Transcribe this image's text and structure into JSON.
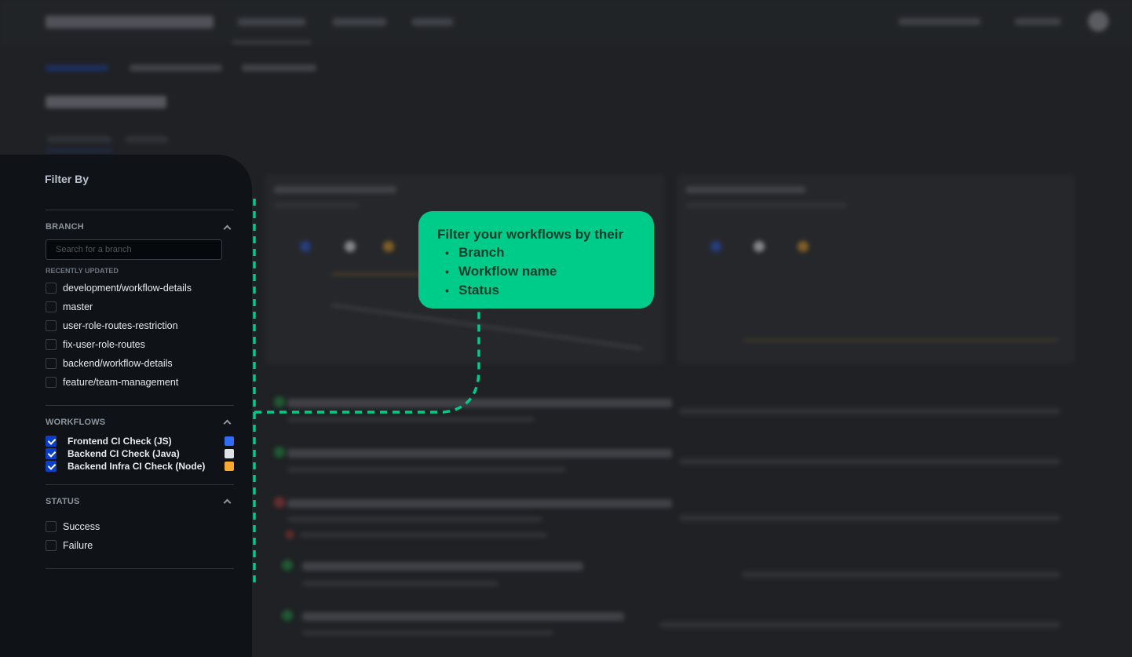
{
  "filter_panel": {
    "title": "Filter By",
    "branch": {
      "section_title": "BRANCH",
      "search_placeholder": "Search for a branch",
      "search_value": "",
      "recent_label": "RECENTLY UPDATED",
      "items": [
        {
          "label": "development/workflow-details",
          "checked": false
        },
        {
          "label": "master",
          "checked": false
        },
        {
          "label": "user-role-routes-restriction",
          "checked": false
        },
        {
          "label": "fix-user-role-routes",
          "checked": false
        },
        {
          "label": "backend/workflow-details",
          "checked": false
        },
        {
          "label": "feature/team-management",
          "checked": false
        }
      ]
    },
    "workflows": {
      "section_title": "WORKFLOWS",
      "items": [
        {
          "label": "Frontend CI Check (JS)",
          "checked": true,
          "color": "#2f6df6"
        },
        {
          "label": "Backend CI Check (Java)",
          "checked": true,
          "color": "#dfe2e7"
        },
        {
          "label": "Backend Infra CI Check (Node)",
          "checked": true,
          "color": "#f9a92f"
        }
      ]
    },
    "status": {
      "section_title": "STATUS",
      "items": [
        {
          "label": "Success",
          "checked": false
        },
        {
          "label": "Failure",
          "checked": false
        }
      ]
    }
  },
  "tour_tooltip": {
    "heading": "Filter your workflows by their",
    "bullets": [
      "Branch",
      "Workflow name",
      "Status"
    ],
    "color": "#00cc8a"
  },
  "colors": {
    "accent_checkbox": "#0b3fc7",
    "tour_accent": "#00cc8a",
    "run_success": "#1f8a3e",
    "run_failure": "#a33a3a"
  }
}
